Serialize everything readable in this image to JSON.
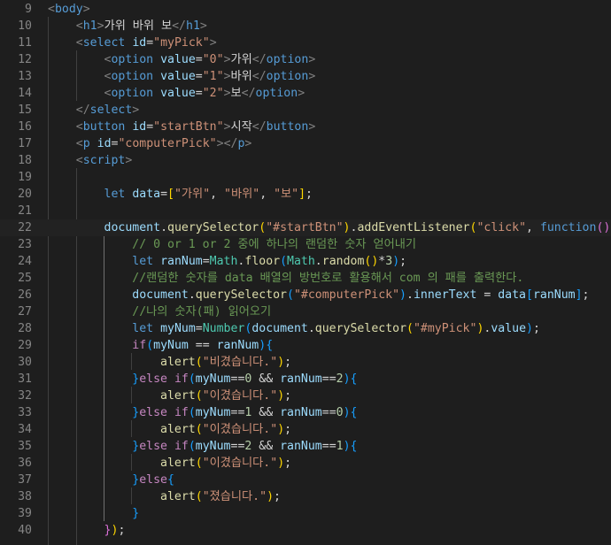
{
  "lines": [
    {
      "num": "9",
      "code": [
        [
          "p",
          "<"
        ],
        [
          "t",
          "body"
        ],
        [
          "p",
          ">"
        ]
      ]
    },
    {
      "num": "10",
      "code": [
        [
          "o",
          "    "
        ],
        [
          "p",
          "<"
        ],
        [
          "t",
          "h1"
        ],
        [
          "p",
          ">"
        ],
        [
          "o",
          "가위 바위 보"
        ],
        [
          "p",
          "</"
        ],
        [
          "t",
          "h1"
        ],
        [
          "p",
          ">"
        ]
      ]
    },
    {
      "num": "11",
      "code": [
        [
          "o",
          "    "
        ],
        [
          "p",
          "<"
        ],
        [
          "t",
          "select"
        ],
        [
          "o",
          " "
        ],
        [
          "a",
          "id"
        ],
        [
          "o",
          "="
        ],
        [
          "s",
          "\"myPick\""
        ],
        [
          "p",
          ">"
        ]
      ]
    },
    {
      "num": "12",
      "code": [
        [
          "o",
          "        "
        ],
        [
          "p",
          "<"
        ],
        [
          "t",
          "option"
        ],
        [
          "o",
          " "
        ],
        [
          "a",
          "value"
        ],
        [
          "o",
          "="
        ],
        [
          "s",
          "\"0\""
        ],
        [
          "p",
          ">"
        ],
        [
          "o",
          "가위"
        ],
        [
          "p",
          "</"
        ],
        [
          "t",
          "option"
        ],
        [
          "p",
          ">"
        ]
      ]
    },
    {
      "num": "13",
      "code": [
        [
          "o",
          "        "
        ],
        [
          "p",
          "<"
        ],
        [
          "t",
          "option"
        ],
        [
          "o",
          " "
        ],
        [
          "a",
          "value"
        ],
        [
          "o",
          "="
        ],
        [
          "s",
          "\"1\""
        ],
        [
          "p",
          ">"
        ],
        [
          "o",
          "바위"
        ],
        [
          "p",
          "</"
        ],
        [
          "t",
          "option"
        ],
        [
          "p",
          ">"
        ]
      ]
    },
    {
      "num": "14",
      "code": [
        [
          "o",
          "        "
        ],
        [
          "p",
          "<"
        ],
        [
          "t",
          "option"
        ],
        [
          "o",
          " "
        ],
        [
          "a",
          "value"
        ],
        [
          "o",
          "="
        ],
        [
          "s",
          "\"2\""
        ],
        [
          "p",
          ">"
        ],
        [
          "o",
          "보"
        ],
        [
          "p",
          "</"
        ],
        [
          "t",
          "option"
        ],
        [
          "p",
          ">"
        ]
      ]
    },
    {
      "num": "15",
      "code": [
        [
          "o",
          "    "
        ],
        [
          "p",
          "</"
        ],
        [
          "t",
          "select"
        ],
        [
          "p",
          ">"
        ]
      ]
    },
    {
      "num": "16",
      "code": [
        [
          "o",
          "    "
        ],
        [
          "p",
          "<"
        ],
        [
          "t",
          "button"
        ],
        [
          "o",
          " "
        ],
        [
          "a",
          "id"
        ],
        [
          "o",
          "="
        ],
        [
          "s",
          "\"startBtn\""
        ],
        [
          "p",
          ">"
        ],
        [
          "o",
          "시작"
        ],
        [
          "p",
          "</"
        ],
        [
          "t",
          "button"
        ],
        [
          "p",
          ">"
        ]
      ]
    },
    {
      "num": "17",
      "code": [
        [
          "o",
          "    "
        ],
        [
          "p",
          "<"
        ],
        [
          "t",
          "p"
        ],
        [
          "o",
          " "
        ],
        [
          "a",
          "id"
        ],
        [
          "o",
          "="
        ],
        [
          "s",
          "\"computerPick\""
        ],
        [
          "p",
          "></"
        ],
        [
          "t",
          "p"
        ],
        [
          "p",
          ">"
        ]
      ]
    },
    {
      "num": "18",
      "code": [
        [
          "o",
          "    "
        ],
        [
          "p",
          "<"
        ],
        [
          "t",
          "script"
        ],
        [
          "p",
          ">"
        ]
      ]
    },
    {
      "num": "19",
      "code": []
    },
    {
      "num": "20",
      "code": [
        [
          "o",
          "        "
        ],
        [
          "k",
          "let"
        ],
        [
          "o",
          " "
        ],
        [
          "v",
          "data"
        ],
        [
          "o",
          "="
        ],
        [
          "b1",
          "["
        ],
        [
          "s",
          "\"가위\""
        ],
        [
          "o",
          ", "
        ],
        [
          "s",
          "\"바위\""
        ],
        [
          "o",
          ", "
        ],
        [
          "s",
          "\"보\""
        ],
        [
          "b1",
          "]"
        ],
        [
          "o",
          ";"
        ]
      ]
    },
    {
      "num": "21",
      "code": []
    },
    {
      "num": "22",
      "code": [
        [
          "o",
          "        "
        ],
        [
          "v",
          "document"
        ],
        [
          "o",
          "."
        ],
        [
          "f",
          "querySelector"
        ],
        [
          "b1",
          "("
        ],
        [
          "s",
          "\"#startBtn\""
        ],
        [
          "b1",
          ")"
        ],
        [
          "o",
          "."
        ],
        [
          "f",
          "addEventListener"
        ],
        [
          "b1",
          "("
        ],
        [
          "s",
          "\"click\""
        ],
        [
          "o",
          ", "
        ],
        [
          "k",
          "function"
        ],
        [
          "b2",
          "()"
        ],
        [
          "b2",
          "{"
        ]
      ]
    },
    {
      "num": "23",
      "code": [
        [
          "o",
          "            "
        ],
        [
          "cm",
          "// 0 or 1 or 2 중에 하나의 랜덤한 숫자 얻어내기"
        ]
      ]
    },
    {
      "num": "24",
      "code": [
        [
          "o",
          "            "
        ],
        [
          "k",
          "let"
        ],
        [
          "o",
          " "
        ],
        [
          "v",
          "ranNum"
        ],
        [
          "o",
          "="
        ],
        [
          "g",
          "Math"
        ],
        [
          "o",
          "."
        ],
        [
          "f",
          "floor"
        ],
        [
          "b3",
          "("
        ],
        [
          "g",
          "Math"
        ],
        [
          "o",
          "."
        ],
        [
          "f",
          "random"
        ],
        [
          "b1",
          "()"
        ],
        [
          "o",
          "*"
        ],
        [
          "n",
          "3"
        ],
        [
          "b3",
          ")"
        ],
        [
          "o",
          ";"
        ]
      ]
    },
    {
      "num": "25",
      "code": [
        [
          "o",
          "            "
        ],
        [
          "cm",
          "//랜덤한 숫자를 data 배열의 방번호로 활용해서 com 의 패를 출력한다."
        ]
      ]
    },
    {
      "num": "26",
      "code": [
        [
          "o",
          "            "
        ],
        [
          "v",
          "document"
        ],
        [
          "o",
          "."
        ],
        [
          "f",
          "querySelector"
        ],
        [
          "b3",
          "("
        ],
        [
          "s",
          "\"#computerPick\""
        ],
        [
          "b3",
          ")"
        ],
        [
          "o",
          "."
        ],
        [
          "v",
          "innerText"
        ],
        [
          "o",
          " = "
        ],
        [
          "v",
          "data"
        ],
        [
          "b3",
          "["
        ],
        [
          "v",
          "ranNum"
        ],
        [
          "b3",
          "]"
        ],
        [
          "o",
          ";"
        ]
      ]
    },
    {
      "num": "27",
      "code": [
        [
          "o",
          "            "
        ],
        [
          "cm",
          "//나의 숫자(패) 읽어오기"
        ]
      ]
    },
    {
      "num": "28",
      "code": [
        [
          "o",
          "            "
        ],
        [
          "k",
          "let"
        ],
        [
          "o",
          " "
        ],
        [
          "v",
          "myNum"
        ],
        [
          "o",
          "="
        ],
        [
          "g",
          "Number"
        ],
        [
          "b3",
          "("
        ],
        [
          "v",
          "document"
        ],
        [
          "o",
          "."
        ],
        [
          "f",
          "querySelector"
        ],
        [
          "b1",
          "("
        ],
        [
          "s",
          "\"#myPick\""
        ],
        [
          "b1",
          ")"
        ],
        [
          "o",
          "."
        ],
        [
          "v",
          "value"
        ],
        [
          "b3",
          ")"
        ],
        [
          "o",
          ";"
        ]
      ]
    },
    {
      "num": "29",
      "code": [
        [
          "o",
          "            "
        ],
        [
          "c",
          "if"
        ],
        [
          "b3",
          "("
        ],
        [
          "v",
          "myNum"
        ],
        [
          "o",
          " == "
        ],
        [
          "v",
          "ranNum"
        ],
        [
          "b3",
          ")"
        ],
        [
          "b3",
          "{"
        ]
      ]
    },
    {
      "num": "30",
      "code": [
        [
          "o",
          "                "
        ],
        [
          "f",
          "alert"
        ],
        [
          "b1",
          "("
        ],
        [
          "s",
          "\"비겼습니다.\""
        ],
        [
          "b1",
          ")"
        ],
        [
          "o",
          ";"
        ]
      ]
    },
    {
      "num": "31",
      "code": [
        [
          "o",
          "            "
        ],
        [
          "b3",
          "}"
        ],
        [
          "c",
          "else"
        ],
        [
          "o",
          " "
        ],
        [
          "c",
          "if"
        ],
        [
          "b3",
          "("
        ],
        [
          "v",
          "myNum"
        ],
        [
          "o",
          "=="
        ],
        [
          "n",
          "0"
        ],
        [
          "o",
          " && "
        ],
        [
          "v",
          "ranNum"
        ],
        [
          "o",
          "=="
        ],
        [
          "n",
          "2"
        ],
        [
          "b3",
          ")"
        ],
        [
          "b3",
          "{"
        ]
      ]
    },
    {
      "num": "32",
      "code": [
        [
          "o",
          "                "
        ],
        [
          "f",
          "alert"
        ],
        [
          "b1",
          "("
        ],
        [
          "s",
          "\"이겼습니다.\""
        ],
        [
          "b1",
          ")"
        ],
        [
          "o",
          ";"
        ]
      ]
    },
    {
      "num": "33",
      "code": [
        [
          "o",
          "            "
        ],
        [
          "b3",
          "}"
        ],
        [
          "c",
          "else"
        ],
        [
          "o",
          " "
        ],
        [
          "c",
          "if"
        ],
        [
          "b3",
          "("
        ],
        [
          "v",
          "myNum"
        ],
        [
          "o",
          "=="
        ],
        [
          "n",
          "1"
        ],
        [
          "o",
          " && "
        ],
        [
          "v",
          "ranNum"
        ],
        [
          "o",
          "=="
        ],
        [
          "n",
          "0"
        ],
        [
          "b3",
          ")"
        ],
        [
          "b3",
          "{"
        ]
      ]
    },
    {
      "num": "34",
      "code": [
        [
          "o",
          "                "
        ],
        [
          "f",
          "alert"
        ],
        [
          "b1",
          "("
        ],
        [
          "s",
          "\"이겼습니다.\""
        ],
        [
          "b1",
          ")"
        ],
        [
          "o",
          ";"
        ]
      ]
    },
    {
      "num": "35",
      "code": [
        [
          "o",
          "            "
        ],
        [
          "b3",
          "}"
        ],
        [
          "c",
          "else"
        ],
        [
          "o",
          " "
        ],
        [
          "c",
          "if"
        ],
        [
          "b3",
          "("
        ],
        [
          "v",
          "myNum"
        ],
        [
          "o",
          "=="
        ],
        [
          "n",
          "2"
        ],
        [
          "o",
          " && "
        ],
        [
          "v",
          "ranNum"
        ],
        [
          "o",
          "=="
        ],
        [
          "n",
          "1"
        ],
        [
          "b3",
          ")"
        ],
        [
          "b3",
          "{"
        ]
      ]
    },
    {
      "num": "36",
      "code": [
        [
          "o",
          "                "
        ],
        [
          "f",
          "alert"
        ],
        [
          "b1",
          "("
        ],
        [
          "s",
          "\"이겼습니다.\""
        ],
        [
          "b1",
          ")"
        ],
        [
          "o",
          ";"
        ]
      ]
    },
    {
      "num": "37",
      "code": [
        [
          "o",
          "            "
        ],
        [
          "b3",
          "}"
        ],
        [
          "c",
          "else"
        ],
        [
          "b3",
          "{"
        ]
      ]
    },
    {
      "num": "38",
      "code": [
        [
          "o",
          "                "
        ],
        [
          "f",
          "alert"
        ],
        [
          "b1",
          "("
        ],
        [
          "s",
          "\"졌습니다.\""
        ],
        [
          "b1",
          ")"
        ],
        [
          "o",
          ";"
        ]
      ]
    },
    {
      "num": "39",
      "code": [
        [
          "o",
          "            "
        ],
        [
          "b3",
          "}"
        ]
      ]
    },
    {
      "num": "40",
      "code": [
        [
          "o",
          "        "
        ],
        [
          "b2",
          "}"
        ],
        [
          "b1",
          ")"
        ],
        [
          "o",
          ";"
        ]
      ]
    }
  ]
}
